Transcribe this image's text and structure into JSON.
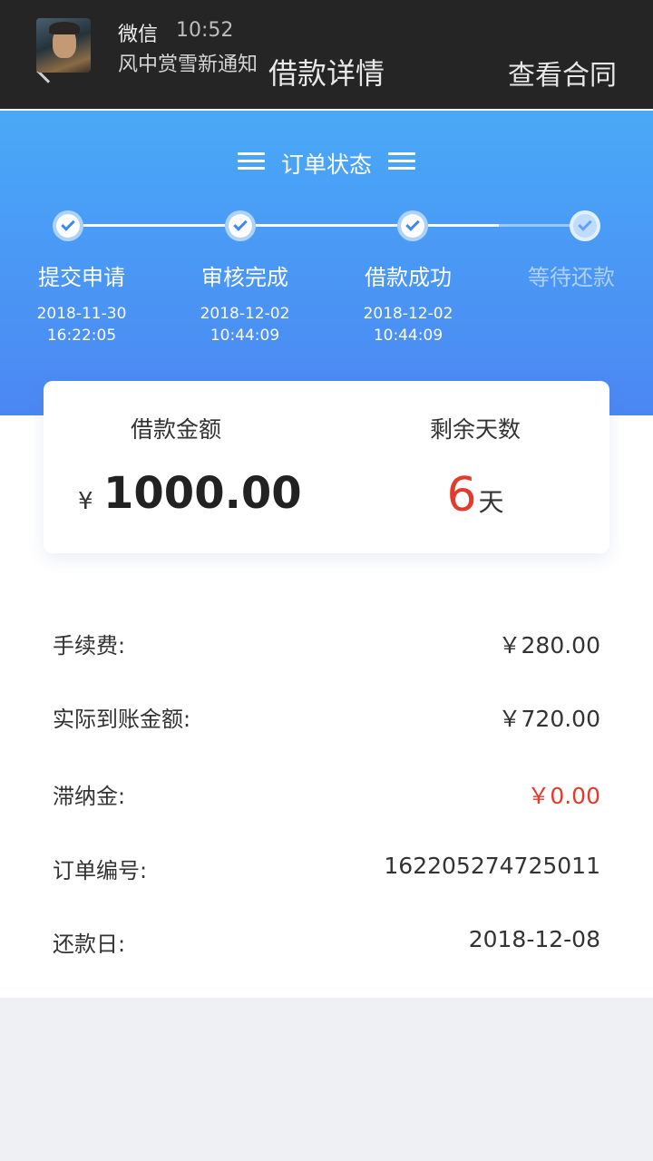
{
  "header": {
    "title": "借款详情",
    "contract_link": "查看合同"
  },
  "notification": {
    "app": "微信",
    "time": "10:52",
    "message": "风中赏雪新通知"
  },
  "status": {
    "title": "订单状态",
    "steps": [
      {
        "label": "提交申请",
        "date": "2018-11-30",
        "time": "16:22:05",
        "done": true
      },
      {
        "label": "审核完成",
        "date": "2018-12-02",
        "time": "10:44:09",
        "done": true
      },
      {
        "label": "借款成功",
        "date": "2018-12-02",
        "time": "10:44:09",
        "done": true
      },
      {
        "label": "等待还款",
        "date": "",
        "time": "",
        "done": false
      }
    ]
  },
  "loan": {
    "amount_label": "借款金额",
    "currency": "¥",
    "amount": "1000.00",
    "days_label": "剩余天数",
    "days": "6",
    "days_unit": "天"
  },
  "details": [
    {
      "key": "手续费:",
      "value": "￥280.00"
    },
    {
      "key": "实际到账金额:",
      "value": "￥720.00"
    },
    {
      "key": "滞纳金:",
      "value": "￥0.00"
    },
    {
      "key": "订单编号:",
      "value": "162205274725011"
    },
    {
      "key": "还款日:",
      "value": "2018-12-08"
    }
  ],
  "colors": {
    "accent_blue": "#4b8df3",
    "highlight_red": "#e23b2b",
    "header_bg": "#252525"
  }
}
